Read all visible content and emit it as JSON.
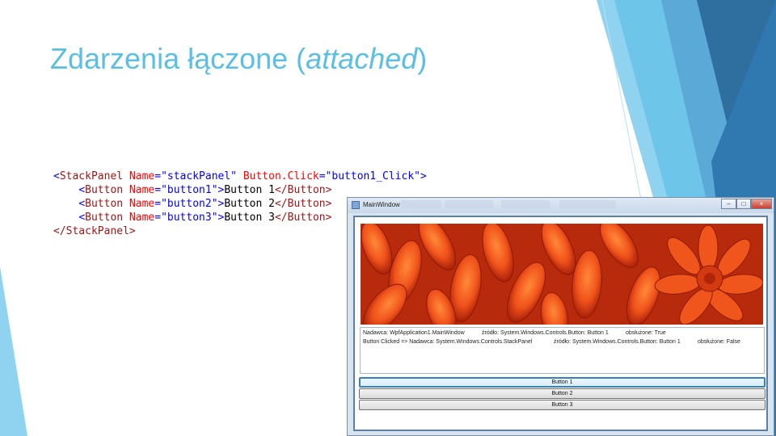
{
  "slide": {
    "title_main": "Zdarzenia łączone (",
    "title_italic": "attached",
    "title_end": ")",
    "colors": {
      "title": "#5bbfe3",
      "accent_dark": "#2e6fa0",
      "accent_light": "#8fd3f0"
    }
  },
  "code": {
    "line1": {
      "open": "<",
      "tag": "StackPanel",
      "a1": "Name",
      "eq1": "=",
      "v1": "\"stackPanel\"",
      "a2": "Button.Click",
      "eq2": "=",
      "v2": "\"button1_Click\"",
      "close": ">"
    },
    "line2": {
      "indent": "    ",
      "open": "<",
      "tag": "Button",
      "a1": "Name",
      "eq1": "=",
      "v1": "\"button1\"",
      "close": ">",
      "text": "Button 1",
      "endtag": "</Button>"
    },
    "line3": {
      "indent": "    ",
      "open": "<",
      "tag": "Button",
      "a1": "Name",
      "eq1": "=",
      "v1": "\"button2\"",
      "close": ">",
      "text": "Button 2",
      "endtag": "</Button>"
    },
    "line4": {
      "indent": "    ",
      "open": "<",
      "tag": "Button",
      "a1": "Name",
      "eq1": "=",
      "v1": "\"button3\"",
      "close": ">",
      "text": "Button 3",
      "endtag": "</Button>"
    },
    "line5": {
      "endtag": "</StackPanel>"
    }
  },
  "window": {
    "title": "MainWindow",
    "controls": {
      "minimize": "–",
      "maximize": "□",
      "close": "×"
    },
    "log": {
      "row1": {
        "a": "Nadawca: WpfApplication1.MainWindow",
        "b": "źródło: System.Windows.Controls.Button: Button 1",
        "c": "obsłużone: True"
      },
      "row2": {
        "a": "Button Clicked =>  Nadawca:  System.Windows.Controls.StackPanel",
        "b": "źródło: System.Windows.Controls.Button: Button 1",
        "c": "obsłużone: False"
      }
    },
    "buttons": [
      "Button 1",
      "Button 2",
      "Button 3"
    ]
  }
}
